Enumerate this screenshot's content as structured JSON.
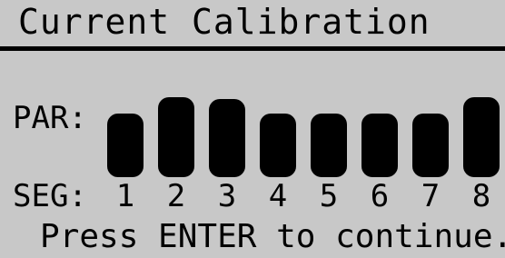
{
  "screen": {
    "title": "Current Calibration",
    "par_label": "PAR:",
    "seg_label": "SEG:",
    "footer": "Press ENTER to continue."
  },
  "segments": [
    {
      "label": "1",
      "level": 0.78
    },
    {
      "label": "2",
      "level": 0.98
    },
    {
      "label": "3",
      "level": 0.95
    },
    {
      "label": "4",
      "level": 0.78
    },
    {
      "label": "5",
      "level": 0.78
    },
    {
      "label": "6",
      "level": 0.78
    },
    {
      "label": "7",
      "level": 0.78
    },
    {
      "label": "8",
      "level": 0.98
    }
  ],
  "colors": {
    "background": "#c8c8c8",
    "foreground": "#000000"
  }
}
